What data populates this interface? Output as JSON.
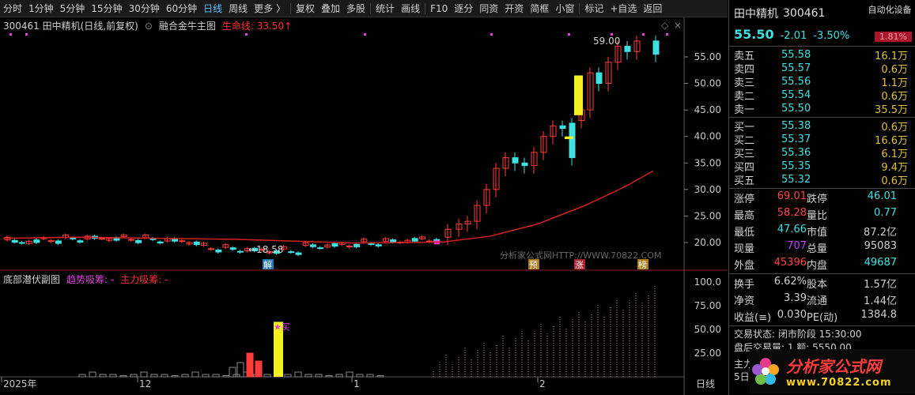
{
  "toolbar": {
    "items": [
      "分时",
      "1分钟",
      "5分钟",
      "15分钟",
      "30分钟",
      "60分钟",
      "日线",
      "周线",
      "更多",
      "复权",
      "叠加",
      "多股",
      "统计",
      "画线",
      "F10",
      "逐分",
      "同资",
      "开资",
      "简框",
      "小窗",
      "标记",
      "+自选",
      "返回"
    ]
  },
  "main": {
    "code_name": "300461 田中精机(日线,前复权)",
    "indicator": "融合金牛主图",
    "lifeline_label": "生命线: 33.50↑",
    "high_label": "59.00",
    "low_label": "18.58",
    "watermark": "分析家公式网HTTP://WWW.70822.COM",
    "markers": [
      {
        "text": "解",
        "color": "#1f7ab0"
      },
      {
        "text": "预",
        "color": "#b07a1f"
      },
      {
        "text": "涨",
        "color": "#b01f2a"
      },
      {
        "text": "榜",
        "color": "#b07a1f"
      }
    ],
    "y_ticks": [
      "55.00",
      "50.00",
      "45.00",
      "40.00",
      "35.00",
      "30.00",
      "25.00",
      "20.00"
    ]
  },
  "sub": {
    "title": "底部潜伏副图",
    "trend_label": "趋势吸筹: -",
    "main_label": "主力吸筹: -",
    "buy_label": "★买",
    "y_ticks": [
      "100.0",
      "75.00",
      "50.00",
      "25.00"
    ]
  },
  "x_axis": {
    "labels": [
      "2025年",
      "12",
      "1",
      "2"
    ],
    "period": "日线"
  },
  "quote": {
    "name": "田中精机",
    "code": "300461",
    "auto_label": "自动化设备",
    "price": "55.50",
    "change": "-2.01",
    "pct": "-3.50%",
    "badge": "1.81%",
    "asks": [
      {
        "label": "卖五",
        "price": "55.58",
        "vol": "16.1万"
      },
      {
        "label": "卖四",
        "price": "55.57",
        "vol": "0.6万"
      },
      {
        "label": "卖三",
        "price": "55.56",
        "vol": "1.1万"
      },
      {
        "label": "卖二",
        "price": "55.54",
        "vol": "0.6万"
      },
      {
        "label": "卖一",
        "price": "55.50",
        "vol": "35.5万"
      }
    ],
    "bids": [
      {
        "label": "买一",
        "price": "55.38",
        "vol": "0.6万"
      },
      {
        "label": "买二",
        "price": "55.37",
        "vol": "16.6万"
      },
      {
        "label": "买三",
        "price": "55.36",
        "vol": "6.1万"
      },
      {
        "label": "买四",
        "price": "55.35",
        "vol": "9.4万"
      },
      {
        "label": "买五",
        "price": "55.32",
        "vol": "0.6万"
      }
    ],
    "stats1": [
      [
        "涨停",
        "69.01",
        "#ff4444",
        "跌停",
        "46.01",
        "#3fe0e0"
      ],
      [
        "最高",
        "58.28",
        "#ff4444",
        "量比",
        "0.77",
        "#3fe0e0"
      ],
      [
        "最低",
        "47.66",
        "#3fe0e0",
        "市值",
        "87.2亿",
        "#d0d0d0"
      ],
      [
        "现量",
        "707",
        "#c040ff",
        "总量",
        "95083",
        "#d0d0d0"
      ],
      [
        "外盘",
        "45396",
        "#ff4444",
        "内盘",
        "49687",
        "#3fe0e0"
      ]
    ],
    "stats2": [
      [
        "换手",
        "6.62%",
        "股本",
        "1.57亿"
      ],
      [
        "净资",
        "3.39",
        "流通",
        "1.44亿"
      ],
      [
        "收益(≡)",
        "0.030",
        "PE(动)",
        "1384.8"
      ]
    ],
    "trade_status": "交易状态: 闭市阶段 15:30:00",
    "after_hours": "盘后交易量: 1  额: 5550.00",
    "bottom_left_1": "主力",
    "bottom_left_2": "5日",
    "logo_text": "分析家公式网",
    "logo_url": "www.70822.com"
  }
}
